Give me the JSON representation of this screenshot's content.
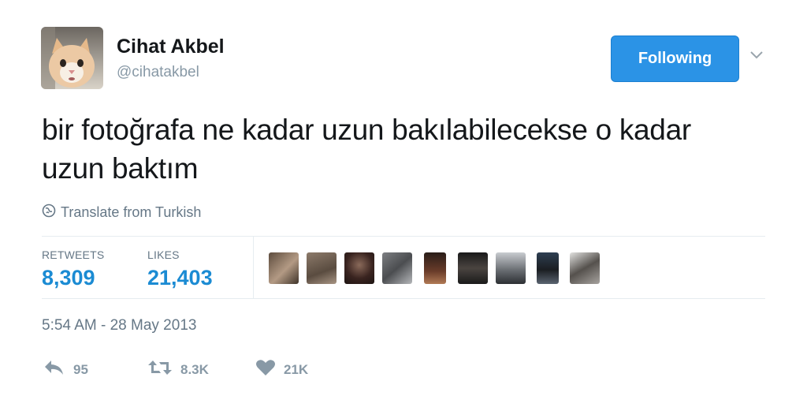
{
  "author": {
    "name": "Cihat Akbel",
    "handle": "@cihatakbel"
  },
  "follow_button": {
    "label": "Following"
  },
  "tweet": {
    "text_line1": "bir fotoğrafa ne kadar uzun bakılabilecekse o kadar",
    "text_line2": "uzun baktım",
    "translate_label": "Translate from Turkish"
  },
  "stats": {
    "retweets_label": "RETWEETS",
    "retweets_value": "8,309",
    "likes_label": "LIKES",
    "likes_value": "21,403"
  },
  "timestamp": "5:54 AM - 28 May 2013",
  "actions": {
    "reply_count": "95",
    "retweet_count": "8.3K",
    "like_count": "21K"
  },
  "icons": {
    "globe": "globe-icon",
    "reply": "reply-icon",
    "retweet": "retweet-icon",
    "like": "heart-icon",
    "dropdown": "chevron-down-icon"
  },
  "colors": {
    "accent": "#2b93e6",
    "stat_value": "#1b8bd3",
    "muted": "#8899a6",
    "divider": "#e6ecf0"
  }
}
